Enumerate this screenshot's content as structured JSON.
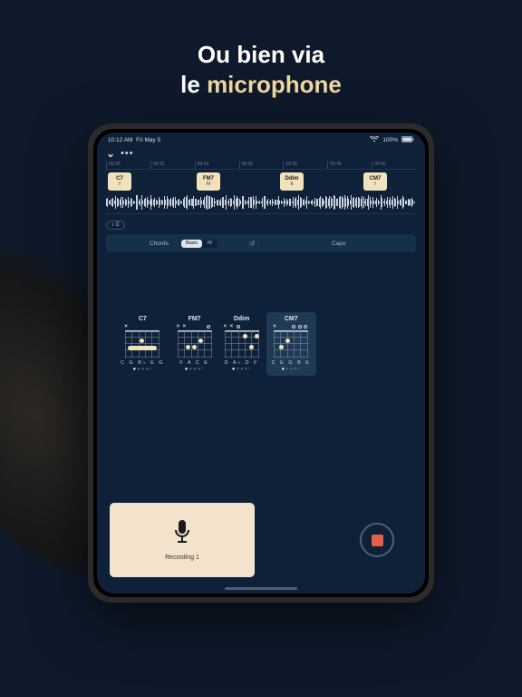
{
  "headline": {
    "line1": "Ou bien via",
    "line2_prefix": "le ",
    "line2_accent": "microphone"
  },
  "status": {
    "time": "10:12 AM",
    "date": "Fri May 5",
    "battery": "100%"
  },
  "ruler": [
    "00:30",
    "00:32",
    "00:34",
    "00:36",
    "00:38",
    "00:40",
    "00:42"
  ],
  "timeline_chords": [
    {
      "name": "C7",
      "roman": "I",
      "pos": 2
    },
    {
      "name": "FM7",
      "roman": "IV",
      "pos": 100
    },
    {
      "name": "Ddim",
      "roman": "ii",
      "pos": 192
    },
    {
      "name": "CM7",
      "roman": "I",
      "pos": 284
    }
  ],
  "key_badge": "♪ C",
  "panel": {
    "left_label": "Chords",
    "seg": [
      {
        "label": "Basic",
        "on": true
      },
      {
        "label": "All",
        "on": false
      }
    ],
    "right_label": "Capo"
  },
  "chords": [
    {
      "name": "C7",
      "notes": "C G B♭ E G",
      "selected": false
    },
    {
      "name": "FM7",
      "notes": "F A C E",
      "selected": false
    },
    {
      "name": "Ddim",
      "notes": "D A♭ D F",
      "selected": false
    },
    {
      "name": "CM7",
      "notes": "C E G B E",
      "selected": true
    }
  ],
  "recording": {
    "title": "Recording 1"
  }
}
